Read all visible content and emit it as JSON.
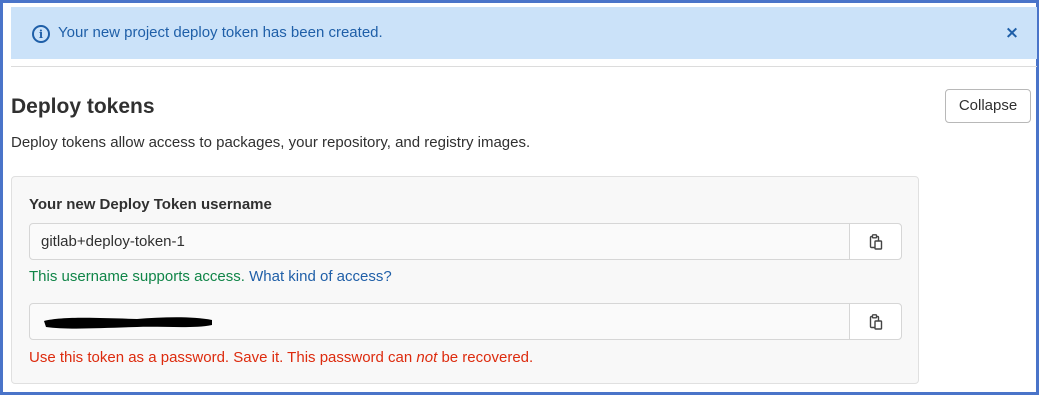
{
  "alert": {
    "message": "Your new project deploy token has been created.",
    "close_label": "×",
    "icon": "info-icon"
  },
  "section": {
    "title": "Deploy tokens",
    "collapse_label": "Collapse",
    "description": "Deploy tokens allow access to packages, your repository, and registry images."
  },
  "token": {
    "username_label": "Your new Deploy Token username",
    "username_value": "gitlab+deploy-token-1",
    "username_help": "This username supports access.",
    "username_help_link": "What kind of access?",
    "password_value": "",
    "password_help_before": "Use this token as a password. Save it. This password can ",
    "password_help_emph": "not",
    "password_help_after": " be recovered.",
    "copy_icon": "clipboard-icon"
  },
  "colors": {
    "alert_bg": "#cbe2f9",
    "info_blue": "#1f5fa8",
    "success_green": "#108548",
    "danger_red": "#dd2b0e",
    "frame_border": "#4a74c9"
  }
}
